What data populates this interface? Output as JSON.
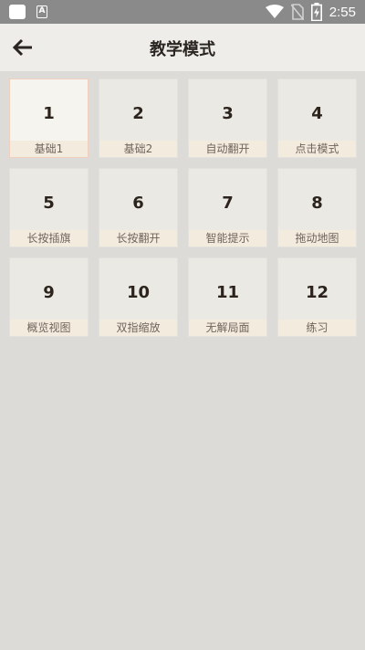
{
  "status_bar": {
    "time": "2:55",
    "notification_icons": [
      "square-icon",
      "a-icon"
    ],
    "system_icons": [
      "wifi-icon",
      "no-sim-icon",
      "battery-charging-icon"
    ]
  },
  "header": {
    "title": "教学模式",
    "back_icon": "arrow-left-icon"
  },
  "colors": {
    "background": "#dcdbd7",
    "app_bar": "#efede9",
    "tile": "#ebe9e4",
    "tile_selected": "#f6f4ef",
    "label_band": "#f4ebdf",
    "status_bar": "#8a8a8a"
  },
  "levels": [
    {
      "number": "1",
      "label": "基础1",
      "selected": true
    },
    {
      "number": "2",
      "label": "基础2"
    },
    {
      "number": "3",
      "label": "自动翻开"
    },
    {
      "number": "4",
      "label": "点击模式"
    },
    {
      "number": "5",
      "label": "长按插旗"
    },
    {
      "number": "6",
      "label": "长按翻开"
    },
    {
      "number": "7",
      "label": "智能提示"
    },
    {
      "number": "8",
      "label": "拖动地图"
    },
    {
      "number": "9",
      "label": "概览视图"
    },
    {
      "number": "10",
      "label": "双指缩放"
    },
    {
      "number": "11",
      "label": "无解局面"
    },
    {
      "number": "12",
      "label": "练习"
    }
  ]
}
